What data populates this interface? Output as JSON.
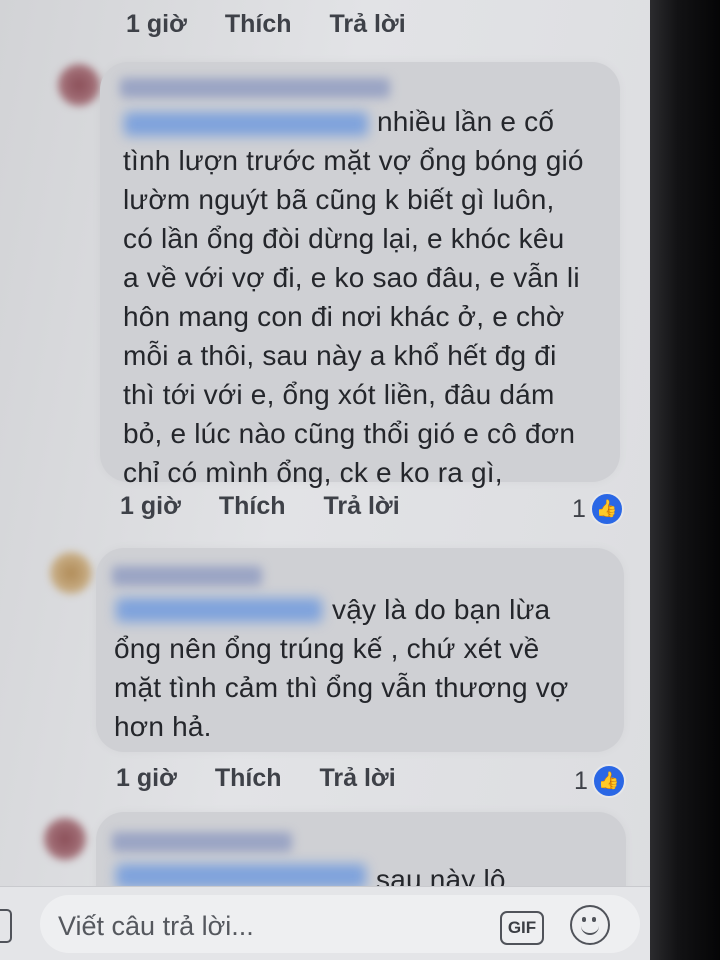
{
  "comments": [
    {
      "id": "c0",
      "actions": {
        "time": "1 giờ",
        "like": "Thích",
        "reply": "Trả lời"
      }
    },
    {
      "id": "c1",
      "text": "nhiều lần e cố\ntình lượn trước mặt vợ ổng bóng gió\nlườm nguýt bã cũng k biết gì luôn,\ncó lần ổng đòi dừng lại, e khóc kêu\na về với vợ đi, e ko sao đâu, e vẫn li\nhôn mang con đi nơi khác ở, e chờ\nmỗi a thôi, sau này a khổ hết đg đi\nthì tới với e, ổng xót liền, đâu dám\nbỏ, e lúc nào cũng thổi gió e cô đơn\nchỉ có mình ổng, ck e ko ra gì,",
      "actions": {
        "time": "1 giờ",
        "like": "Thích",
        "reply": "Trả lời"
      },
      "reaction_count": "1"
    },
    {
      "id": "c2",
      "text": "vậy là do bạn lừa\nổng nên ổng trúng kế , chứ xét về\nmặt tình cảm thì ổng vẫn thương vợ\nhơn hả.",
      "actions": {
        "time": "1 giờ",
        "like": "Thích",
        "reply": "Trả lời"
      },
      "reaction_count": "1"
    },
    {
      "id": "c3",
      "text": "sau này lô"
    }
  ],
  "reply_box": {
    "placeholder": "Viết câu trả lời...",
    "gif_label": "GIF"
  },
  "icons": {
    "like": "thumbs-up-icon",
    "emoji": "smiley-icon",
    "camera": "camera-icon"
  },
  "colors": {
    "bubble": "#cfd0d4",
    "link": "#3b6fd1",
    "like": "#2a67e5"
  }
}
